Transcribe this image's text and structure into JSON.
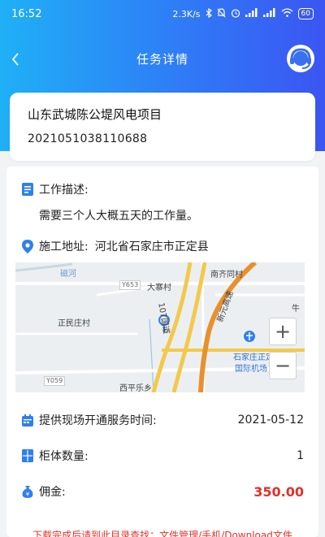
{
  "status_bar": {
    "time": "16:52",
    "net_speed": "2.3K/s",
    "battery": "60"
  },
  "nav": {
    "title": "任务详情"
  },
  "project": {
    "name": "山东武城陈公堤风电项目",
    "code": "2021051038110688"
  },
  "details": {
    "work_desc_label": "工作描述:",
    "work_desc_value": "需要三个人大概五天的工作量。",
    "address_label": "施工地址:",
    "address_value": "河北省石家庄市正定县",
    "service_time_label": "提供现场开通服务时间:",
    "service_time_value": "2021-05-12",
    "cabinet_label": "柜体数量:",
    "cabinet_value": "1",
    "commission_label": "佣金:",
    "commission_value": "350.00"
  },
  "map": {
    "labels": {
      "l1": "南齐同村",
      "l2": "大寨村",
      "l3": "正民庄村",
      "l4": "牛",
      "l5": "西平乐乡",
      "l6": "新元高速",
      "l7": "107国道",
      "l8": "石家庄正定",
      "l9": "国际机场",
      "l10": "磁河"
    },
    "road_tags": {
      "t1": "Y653",
      "t2": "Y059"
    },
    "zoom_in": "+",
    "zoom_out": "−"
  },
  "notice": "下载完成后请到此目录查找：文件管理/手机/Download文件",
  "colors": {
    "header_start": "#1fb0f6",
    "header_end": "#3b55f2",
    "icon_blue": "#2f80ed",
    "price_red": "#e0312a"
  }
}
